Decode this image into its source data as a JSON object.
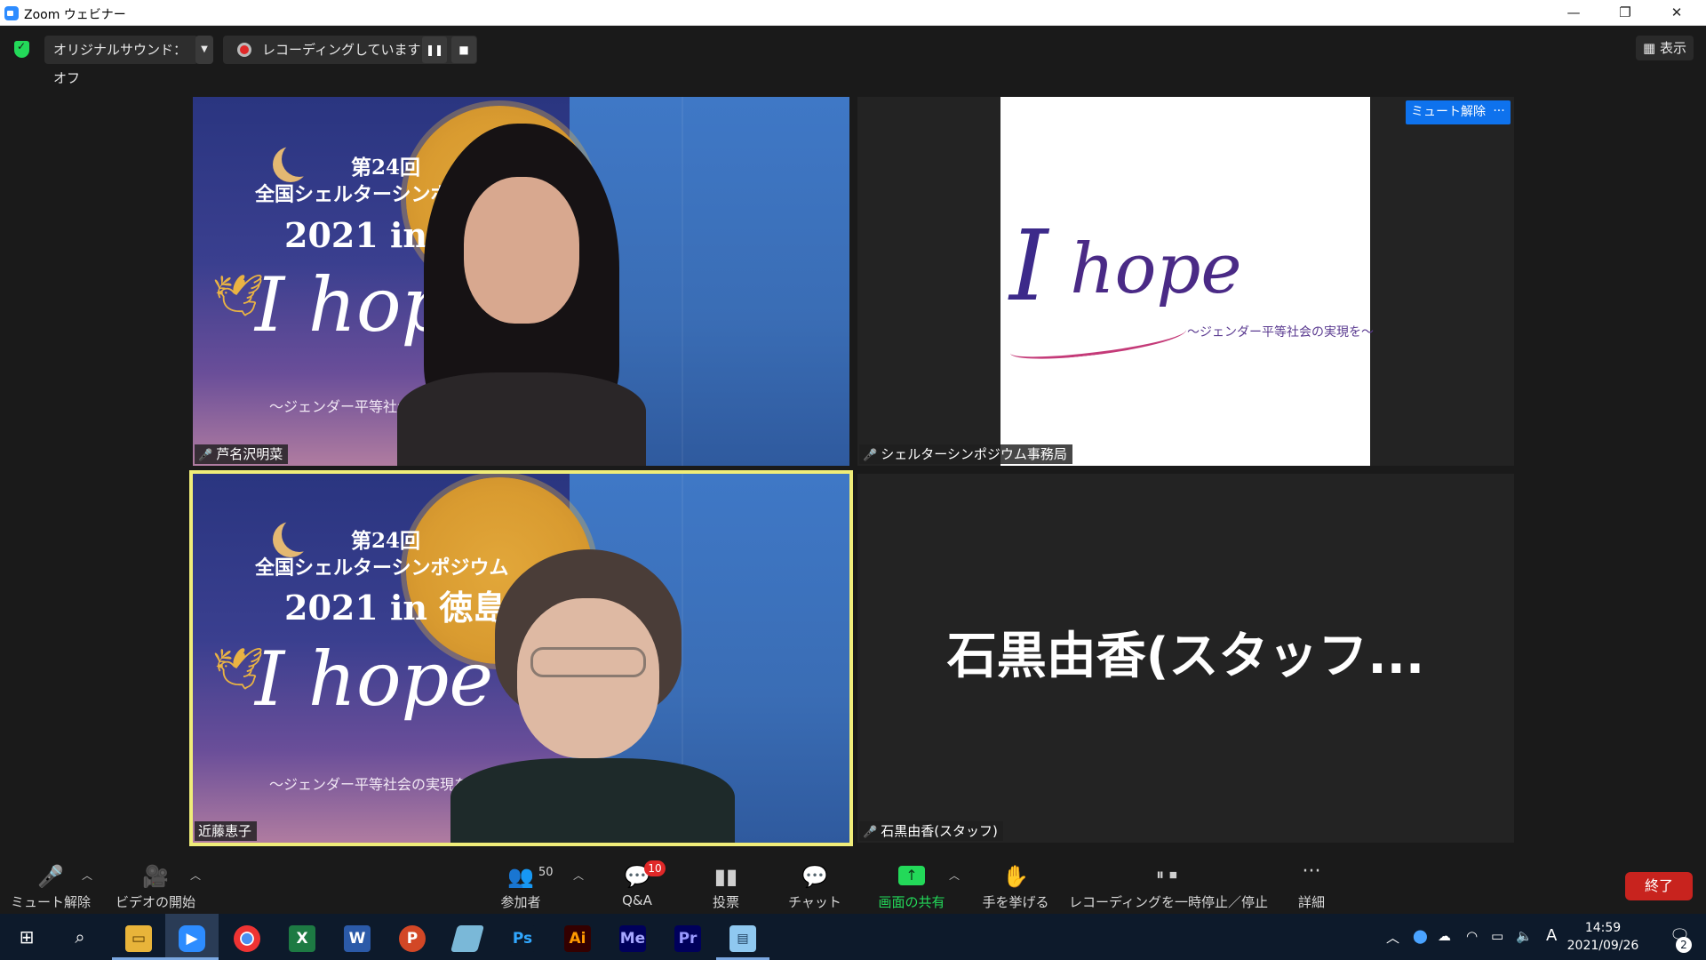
{
  "window": {
    "title": "Zoom ウェビナー",
    "controls": {
      "minimize": "—",
      "restore": "❐",
      "close": "✕"
    }
  },
  "topbar": {
    "original_sound": "オリジナルサウンド：オフ",
    "recording_status": "レコーディングしています...",
    "view_label": "表示"
  },
  "tiles": [
    {
      "name": "芦名沢明菜",
      "muted": true,
      "poster": {
        "line1": "第24回",
        "line2": "全国シェルターシンポジウム",
        "line3": "2021 in 徳島",
        "hope": "I hope",
        "sub": "〜ジェンダー平等社会の実現を〜"
      }
    },
    {
      "name": "シェルターシンポジウム事務局",
      "muted": true,
      "slide": {
        "hope": "hope",
        "sub": "〜ジェンダー平等社会の実現を〜"
      },
      "unmute_label": "ミュート解除",
      "more_label": "···"
    },
    {
      "name": "近藤恵子",
      "muted": false,
      "active_speaker": true,
      "poster": {
        "line1": "第24回",
        "line2": "全国シェルターシンポジウム",
        "line3": "2021 in 徳島",
        "hope": "I hope",
        "sub": "〜ジェンダー平等社会の実現を〜"
      }
    },
    {
      "name": "石黒由香(スタッフ)",
      "muted": true,
      "display_name": "石黒由香(スタッフ..."
    }
  ],
  "toolbar": {
    "unmute": "ミュート解除",
    "start_video": "ビデオの開始",
    "participants": "参加者",
    "participants_count": "50",
    "qa": "Q&A",
    "qa_badge": "10",
    "polls": "投票",
    "chat": "チャット",
    "share_screen": "画面の共有",
    "raise_hand": "手を挙げる",
    "recording": "レコーディングを一時停止／停止",
    "more": "詳細",
    "end": "終了"
  },
  "taskbar": {
    "apps": [
      "start",
      "search",
      "explorer",
      "zoom",
      "chrome",
      "excel",
      "word",
      "powerpoint",
      "stylus",
      "photoshop",
      "illustrator",
      "media-encoder",
      "premiere",
      "control-panel"
    ],
    "app_labels": {
      "excel": "X",
      "word": "W",
      "powerpoint": "P",
      "photoshop": "Ps",
      "illustrator": "Ai",
      "media_encoder": "Me",
      "premiere": "Pr"
    },
    "ime": "A",
    "time": "14:59",
    "date": "2021/09/26",
    "notifications": "2"
  },
  "colors": {
    "accent_blue": "#0e72ed",
    "active_speaker_border": "#f0ed79",
    "end_button": "#c8231e",
    "share_green": "#23d959",
    "badge_red": "#e02828"
  }
}
